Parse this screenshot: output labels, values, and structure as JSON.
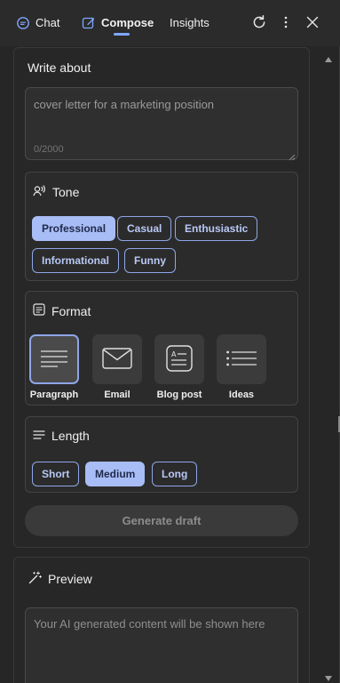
{
  "tabs": [
    {
      "label": "Chat",
      "icon": "chat-icon"
    },
    {
      "label": "Compose",
      "icon": "compose-icon",
      "active": true
    },
    {
      "label": "Insights"
    }
  ],
  "toolbar": {
    "refresh_icon": "refresh-icon",
    "more_icon": "more-vertical-icon",
    "close_icon": "close-icon"
  },
  "write_about": {
    "title": "Write about",
    "value": "cover letter for a marketing position",
    "counter": "0/2000"
  },
  "tone": {
    "title": "Tone",
    "options": [
      "Professional",
      "Casual",
      "Enthusiastic",
      "Informational",
      "Funny"
    ],
    "selected": "Professional"
  },
  "format": {
    "title": "Format",
    "options": [
      "Paragraph",
      "Email",
      "Blog post",
      "Ideas"
    ],
    "selected": "Paragraph"
  },
  "length": {
    "title": "Length",
    "options": [
      "Short",
      "Medium",
      "Long"
    ],
    "selected": "Medium"
  },
  "generate_label": "Generate draft",
  "preview": {
    "title": "Preview",
    "placeholder": "Your AI generated content will be shown here"
  },
  "colors": {
    "accent": "#8ea6e8",
    "selected_chip": "#a8bcf5",
    "background": "#262626"
  }
}
